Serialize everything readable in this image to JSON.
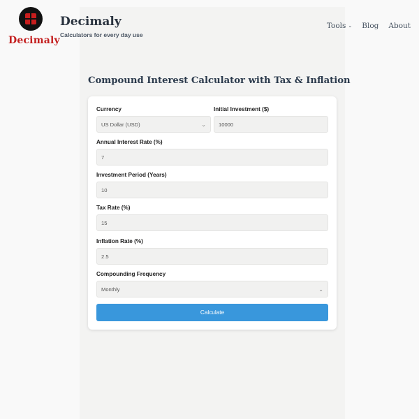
{
  "site": {
    "logo_text": "Decimaly",
    "title": "Decimaly",
    "tagline": "Calculators for every day use"
  },
  "nav": {
    "items": [
      {
        "label": "Tools",
        "icon": "chevron-down-icon"
      },
      {
        "label": "Blog"
      },
      {
        "label": "About"
      }
    ]
  },
  "page": {
    "title": "Compound Interest Calculator with Tax & Inflation"
  },
  "form": {
    "currency": {
      "label": "Currency",
      "value": "US Dollar (USD)"
    },
    "initial_investment": {
      "label": "Initial Investment ($)",
      "value": "10000"
    },
    "interest_rate": {
      "label": "Annual Interest Rate (%)",
      "value": "7"
    },
    "period": {
      "label": "Investment Period (Years)",
      "value": "10"
    },
    "tax_rate": {
      "label": "Tax Rate (%)",
      "value": "15"
    },
    "inflation_rate": {
      "label": "Inflation Rate (%)",
      "value": "2.5"
    },
    "compounding": {
      "label": "Compounding Frequency",
      "value": "Monthly"
    },
    "submit_label": "Calculate"
  },
  "colors": {
    "accent": "#3997dc",
    "logo_red": "#c41f1f"
  }
}
